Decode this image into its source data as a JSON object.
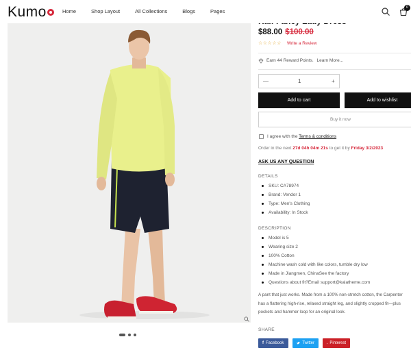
{
  "header": {
    "logo": "Kumo",
    "nav": [
      "Home",
      "Shop Layout",
      "All Collections",
      "Blogs",
      "Pages"
    ],
    "cart_count": "0"
  },
  "product": {
    "title": "Half Fancy Lady Dress",
    "price": "$88.00",
    "old_price": "$100.00",
    "rating_stars": "☆☆☆☆☆",
    "review_link": "Write a Review",
    "reward_text": "Earn 44 Reward Points.",
    "learn_more": "Learn More...",
    "quantity": "1",
    "qty_minus": "—",
    "qty_plus": "+",
    "add_to_cart": "Add to cart",
    "add_to_wishlist": "Add to wishlist",
    "buy_now": "Buy it now",
    "agree_prefix": "I agree with the",
    "agree_link": "Terms & conditions",
    "order_prefix": "Order in the next",
    "order_countdown": "27d 04h 04m 21s",
    "order_middle": "to get it by",
    "order_date": "Friday 3/2/2023",
    "ask_question": "ASK US ANY QUESTION"
  },
  "details": {
    "title": "DETAILS",
    "items": [
      "SKU: CA78974",
      "Brand: Vendor 1",
      "Type: Men's Clothing",
      "Availability: In Stock"
    ]
  },
  "description": {
    "title": "DESCRIPTION",
    "items": [
      "Model is 5",
      "Wearing size 2",
      "100% Cotton",
      "Machine wash cold with like colors, tumble dry low",
      "Made in Jiangmen, ChinaSee the factory",
      "Questions about fit?Email support@kalatheme.com"
    ],
    "paragraph": [
      "A pant that just works. Made from a 100% non-stretch cotton, the Carpenter",
      "has a flattering high-rise, relaxed straight leg, and slightly cropped fit—plus",
      "pockets and hammer loop for an original look."
    ]
  },
  "share": {
    "title": "SHARE",
    "facebook": "Facebook",
    "twitter": "Twitter",
    "pinterest": "Pinterest"
  },
  "colors": {
    "accent": "#d6283b",
    "facebook": "#3b5a9a",
    "twitter": "#1da1f2",
    "pinterest": "#cb2027"
  }
}
